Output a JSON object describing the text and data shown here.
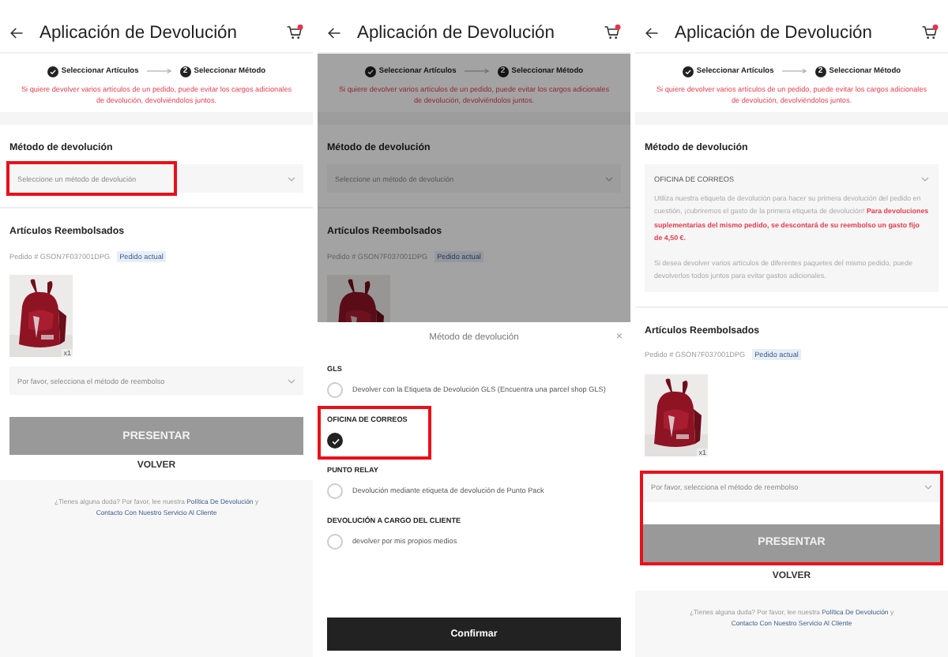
{
  "screens": [
    {
      "header": {
        "title": "Aplicación de Devolución"
      },
      "steps": [
        {
          "label": "Seleccionar Artículos",
          "done": true
        },
        {
          "label": "Seleccionar Método",
          "number": "2",
          "done": false
        }
      ],
      "notice": "Si quiere devolver varios artículos de un pedido, puede evitar los cargos adicionales de devolución, devolviéndolos juntos.",
      "return_method": {
        "heading": "Método de devolución",
        "select": {
          "placeholder": "Seleccione un método de devolución",
          "highlighted": true
        }
      },
      "refunded_items": {
        "heading": "Artículos Reembolsados",
        "order": "Pedido # GSON7F037001DPG",
        "order_badge": "Pedido actual",
        "items": [
          {
            "kind": "picture",
            "quantity": "x1"
          }
        ]
      },
      "refund_block": {
        "highlighted": false,
        "select": {
          "placeholder": "Por favor, selecciona el método de reembolso"
        },
        "submit": "PRESENTAR"
      },
      "back": "VOLVER",
      "help": [
        {
          "kind": "text",
          "text": "¿Tienes alguna duda? Por favor, lee nuestra"
        },
        {
          "kind": "link",
          "text": "Política De Devolución"
        },
        {
          "kind": "text",
          "text": "y"
        },
        {
          "kind": "link",
          "text": "Contacto Con Nuestro Servicio Al Cliente"
        }
      ]
    },
    {
      "dimmed": true,
      "header": {
        "title": "Aplicación de Devolución"
      },
      "steps": [
        {
          "label": "Seleccionar Artículos",
          "done": true
        },
        {
          "label": "Seleccionar Método",
          "number": "2",
          "done": false
        }
      ],
      "notice": "Si quiere devolver varios artículos de un pedido, puede evitar los cargos adicionales de devolución, devolviéndolos juntos.",
      "return_method": {
        "heading": "Método de devolución",
        "select": {
          "placeholder": "Seleccione un método de devolución",
          "highlighted": false
        }
      },
      "refunded_items": {
        "heading": "Artículos Reembolsados",
        "order": "Pedido # GSON7F037001DPG",
        "order_badge": "Pedido actual"
      },
      "sheet": {
        "title": "Método de devolución",
        "close": "×",
        "confirm": "Confirmar",
        "groups": [
          {
            "heading": "GLS",
            "highlighted": false,
            "options": [
              {
                "label": "Devolver con la Etiqueta de Devolución GLS (Encuentra una parcel shop GLS)",
                "selected": false
              }
            ]
          },
          {
            "heading": "OFICINA DE CORREOS",
            "highlighted": true,
            "options": [
              {
                "selected": true
              }
            ]
          },
          {
            "heading": "PUNTO RELAY",
            "highlighted": false,
            "options": [
              {
                "label": "Devolución mediante etiqueta de devolución de Punto Pack",
                "selected": false
              }
            ]
          },
          {
            "heading": "DEVOLUCIÓN A CARGO DEL CLIENTE",
            "highlighted": false,
            "options": [
              {
                "label": "devolver por mis propios medios",
                "selected": false
              }
            ]
          }
        ]
      }
    },
    {
      "header": {
        "title": "Aplicación de Devolución"
      },
      "steps": [
        {
          "label": "Seleccionar Artículos",
          "done": true
        },
        {
          "label": "Seleccionar Método",
          "number": "2",
          "done": false
        }
      ],
      "notice": "Si quiere devolver varios artículos de un pedido, puede evitar los cargos adicionales de devolución, devolviéndolos juntos.",
      "return_method": {
        "heading": "Método de devolución",
        "select": {
          "value": "OFICINA DE CORREOS",
          "expanded": true,
          "highlighted": false,
          "paragraphs": [
            "Utiliza nuestra etiqueta de devolución para hacer su primera devolución del pedido en cuestión, ¡cubriremos el gasto de la primera etiqueta de devolución! **Para devoluciones suplementarias del mismo pedido, se descontará de su reembolso un gasto fijo de 4,50 €.**",
            "Si desea devolver varios artículos de diferentes paquetes del mismo pedido, puede devolverlos todos juntos para evitar gastos adicionales."
          ]
        }
      },
      "refunded_items": {
        "heading": "Artículos Reembolsados",
        "order": "Pedido # GSON7F037001DPG",
        "order_badge": "Pedido actual",
        "items": [
          {
            "kind": "picture",
            "quantity": "x1"
          }
        ]
      },
      "refund_block": {
        "highlighted": true,
        "select": {
          "placeholder": "Por favor, selecciona el método de reembolso"
        },
        "submit": "PRESENTAR"
      },
      "back": "VOLVER",
      "help": [
        {
          "kind": "text",
          "text": "¿Tienes alguna duda? Por favor, lee nuestra"
        },
        {
          "kind": "link",
          "text": "Política De Devolución"
        },
        {
          "kind": "text",
          "text": "y"
        },
        {
          "kind": "link",
          "text": "Contacto Con Nuestro Servicio Al Cliente"
        }
      ]
    }
  ]
}
